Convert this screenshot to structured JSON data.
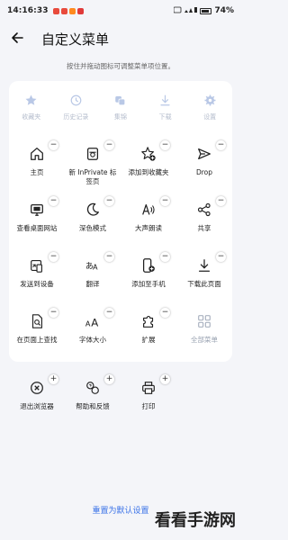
{
  "status": {
    "time": "14:16:33",
    "signal_text": "▮▮▮",
    "battery": "74%"
  },
  "header": {
    "title": "自定义菜单",
    "back_icon": "arrow-left-icon"
  },
  "hint": "按住并拖动图标可调整菜单项位置。",
  "disabled_items": [
    {
      "label": "收藏夹",
      "icon": "star-icon"
    },
    {
      "label": "历史记录",
      "icon": "history-icon"
    },
    {
      "label": "集锦",
      "icon": "collections-icon"
    },
    {
      "label": "下载",
      "icon": "download-icon"
    },
    {
      "label": "设置",
      "icon": "gear-icon"
    }
  ],
  "menu_items": [
    {
      "label": "主页",
      "icon": "home-icon",
      "action": "−"
    },
    {
      "label": "新 InPrivate 标签页",
      "icon": "inprivate-tab-icon",
      "action": "−"
    },
    {
      "label": "添加到收藏夹",
      "icon": "add-favorite-icon",
      "action": "−"
    },
    {
      "label": "Drop",
      "icon": "drop-icon",
      "action": "−"
    },
    {
      "label": "查看桌面网站",
      "icon": "desktop-site-icon",
      "action": "−"
    },
    {
      "label": "深色模式",
      "icon": "moon-icon",
      "action": "−"
    },
    {
      "label": "大声朗读",
      "icon": "read-aloud-icon",
      "action": "−"
    },
    {
      "label": "共享",
      "icon": "share-icon",
      "action": "−"
    },
    {
      "label": "发送到设备",
      "icon": "send-device-icon",
      "action": "−"
    },
    {
      "label": "翻译",
      "icon": "translate-icon",
      "action": "−"
    },
    {
      "label": "添加至手机",
      "icon": "add-to-phone-icon",
      "action": "−"
    },
    {
      "label": "下载此页面",
      "icon": "download-page-icon",
      "action": "−"
    },
    {
      "label": "在页面上查找",
      "icon": "find-on-page-icon",
      "action": "−"
    },
    {
      "label": "字体大小",
      "icon": "font-size-icon",
      "action": "−"
    },
    {
      "label": "扩展",
      "icon": "extensions-icon",
      "action": "−"
    },
    {
      "label": "全部菜单",
      "icon": "all-menu-icon",
      "action": ""
    }
  ],
  "extra_items": [
    {
      "label": "退出浏览器",
      "icon": "exit-icon",
      "action": "+"
    },
    {
      "label": "帮助和反馈",
      "icon": "help-feedback-icon",
      "action": "+"
    },
    {
      "label": "打印",
      "icon": "printer-icon",
      "action": "+"
    }
  ],
  "reset": "重置为默认设置",
  "watermark": "看看手游网",
  "colors": {
    "background": "#f4f5f9",
    "accent": "#3a72e8",
    "disabled": "#b4bccc"
  }
}
